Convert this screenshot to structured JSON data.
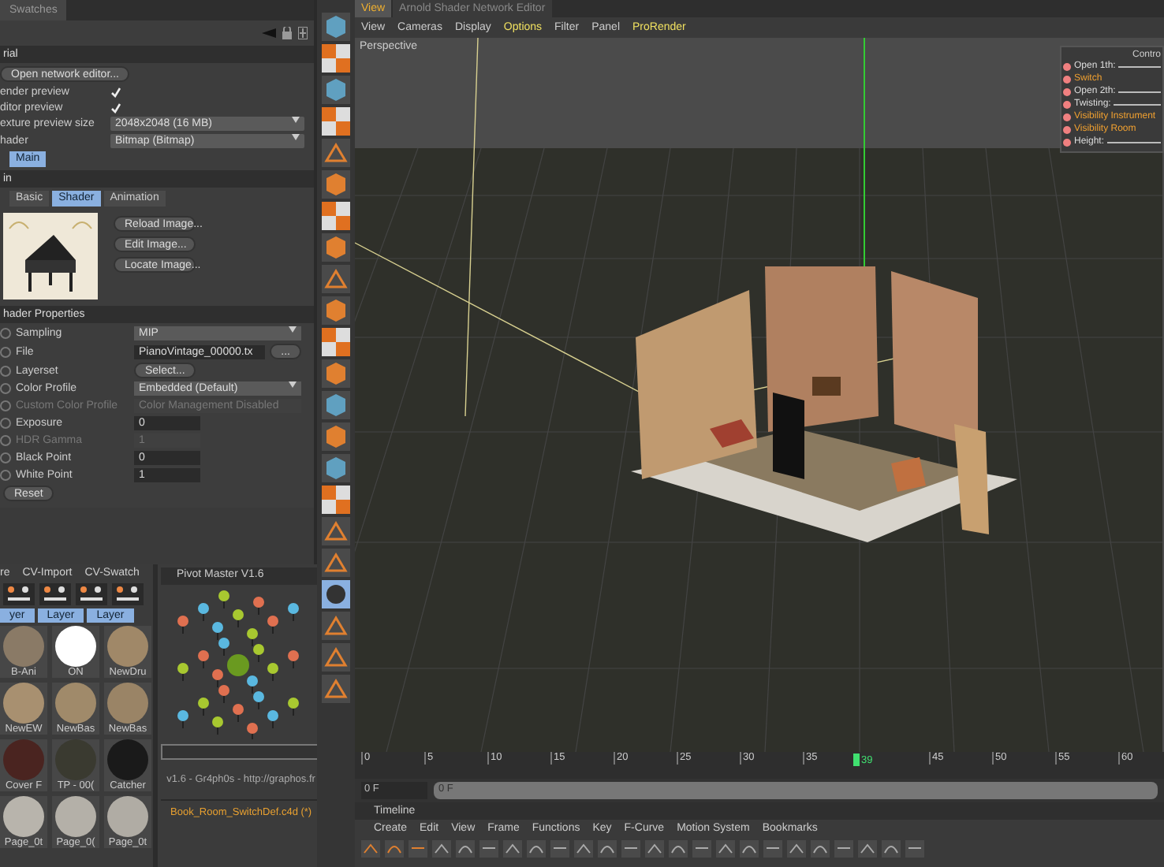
{
  "attribute_panel": {
    "tab": "Swatches",
    "section": "rial",
    "network_button": "Open network editor...",
    "checks": [
      {
        "label": "ender preview",
        "checked": true
      },
      {
        "label": "ditor preview",
        "checked": true
      }
    ],
    "selects": [
      {
        "label": "exture preview size",
        "value": "2048x2048 (16 MB)"
      },
      {
        "label": "hader",
        "value": "Bitmap (Bitmap)"
      }
    ],
    "subtabs": [
      {
        "label": "Main",
        "selected": true
      }
    ],
    "sub_section": "in",
    "shader_tabs": [
      {
        "label": "Basic",
        "selected": false
      },
      {
        "label": "Shader",
        "selected": true
      },
      {
        "label": "Animation",
        "selected": false
      }
    ],
    "image_buttons": [
      "Reload Image...",
      "Edit Image...",
      "Locate Image..."
    ],
    "properties_title": "hader Properties",
    "properties": [
      {
        "kind": "dropdown",
        "label": "Sampling",
        "value": "MIP",
        "disabled": false
      },
      {
        "kind": "file",
        "label": "File",
        "value": "PianoVintage_00000.tx",
        "action": "...",
        "disabled": false
      },
      {
        "kind": "button",
        "label": "Layerset",
        "value": "Select...",
        "disabled": false
      },
      {
        "kind": "dropdown",
        "label": "Color Profile",
        "value": "Embedded (Default)",
        "disabled": false
      },
      {
        "kind": "text",
        "label": "Custom Color Profile",
        "value": "Color Management Disabled",
        "disabled": true
      },
      {
        "kind": "number",
        "label": "Exposure",
        "value": "0",
        "disabled": false
      },
      {
        "kind": "number",
        "label": "HDR Gamma",
        "value": "1",
        "disabled": true
      },
      {
        "kind": "number",
        "label": "Black Point",
        "value": "0",
        "disabled": false
      },
      {
        "kind": "number",
        "label": "White Point",
        "value": "1",
        "disabled": false
      }
    ],
    "reset_button": "Reset"
  },
  "material_browser": {
    "menu": [
      "re",
      "CV-Import",
      "CV-Swatch"
    ],
    "layer_tabs": [
      "yer",
      "Layer",
      "Layer"
    ],
    "materials": [
      {
        "label": "B-Ani",
        "color": "#8a7a66"
      },
      {
        "label": "ON",
        "color": "#ffffff"
      },
      {
        "label": "NewDru",
        "color": "#a08868"
      },
      {
        "label": "NewEW",
        "color": "#a89070"
      },
      {
        "label": "NewBas",
        "color": "#a08a6a"
      },
      {
        "label": "NewBas",
        "color": "#9a8466"
      },
      {
        "label": "Cover F",
        "color": "#4a2420"
      },
      {
        "label": "TP - 00(",
        "color": "#3a3a30"
      },
      {
        "label": "Catcher",
        "color": "#1a1a1a"
      },
      {
        "label": "Page_0t",
        "color": "#b8b4ac"
      },
      {
        "label": "Page_0(",
        "color": "#b4b0a8"
      },
      {
        "label": "Page_0t",
        "color": "#b0aca4"
      }
    ]
  },
  "pivot_master": {
    "title": "Pivot Master V1.6",
    "credit": "v1.6 - Gr4ph0s - http://graphos.fr",
    "file": "Book_Room_SwitchDef.c4d (*)"
  },
  "viewport": {
    "tabs": [
      {
        "label": "View",
        "selected": true
      },
      {
        "label": "Arnold Shader Network Editor",
        "selected": false
      }
    ],
    "menu": [
      {
        "label": "View",
        "highlighted": false
      },
      {
        "label": "Cameras",
        "highlighted": false
      },
      {
        "label": "Display",
        "highlighted": false
      },
      {
        "label": "Options",
        "highlighted": true
      },
      {
        "label": "Filter",
        "highlighted": false
      },
      {
        "label": "Panel",
        "highlighted": false
      },
      {
        "label": "ProRender",
        "highlighted": true
      }
    ],
    "camera": "Perspective",
    "controls": {
      "title": "Contro",
      "items": [
        {
          "label": "Open 1th:",
          "kind": "slider",
          "highlighted": false
        },
        {
          "label": "Switch",
          "kind": "toggle",
          "highlighted": true
        },
        {
          "label": "Open 2th:",
          "kind": "slider",
          "highlighted": false
        },
        {
          "label": "Twisting:",
          "kind": "slider",
          "highlighted": false
        },
        {
          "label": "Visibility Instrument",
          "kind": "toggle",
          "highlighted": true
        },
        {
          "label": "Visibility Room",
          "kind": "toggle",
          "highlighted": true
        },
        {
          "label": "Height:",
          "kind": "slider",
          "highlighted": false
        }
      ]
    }
  },
  "timeline_ruler": {
    "ticks": [
      "0",
      "5",
      "10",
      "15",
      "20",
      "25",
      "30",
      "35",
      "45",
      "50",
      "55",
      "60"
    ],
    "current": "39",
    "start_field": "0 F",
    "range_field": "0 F"
  },
  "timeline": {
    "title": "Timeline",
    "menu": [
      "Create",
      "Edit",
      "View",
      "Frame",
      "Functions",
      "Key",
      "F-Curve",
      "Motion System",
      "Bookmarks"
    ]
  }
}
